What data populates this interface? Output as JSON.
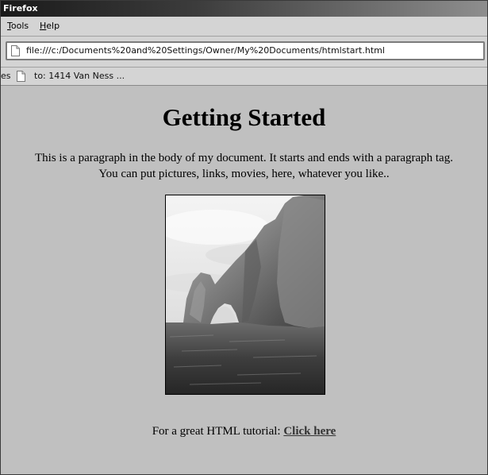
{
  "window": {
    "title": "Firefox"
  },
  "menu": {
    "items": [
      {
        "mnemonic": "T",
        "rest": "ools"
      },
      {
        "mnemonic": "H",
        "rest": "elp"
      }
    ]
  },
  "urlbar": {
    "value": "file:///c:/Documents%20and%20Settings/Owner/My%20Documents/htmlstart.html",
    "icon": "page-icon"
  },
  "bookmarks": {
    "cut_label": "es",
    "items": [
      {
        "label": "to: 1414 Van Ness ...",
        "icon": "page-icon"
      }
    ]
  },
  "page": {
    "heading": "Getting Started",
    "paragraph": "This is a paragraph in the body of my document. It starts and ends with a paragraph tag. You can put pictures, links, movies, here, whatever you like..",
    "image": {
      "icon": "photo-sea-arch"
    },
    "tutorial_prefix": "For a great HTML tutorial: ",
    "tutorial_link": "Click here"
  },
  "colors": {
    "content_background": "#c0c0c0",
    "chrome_background": "#d4d4d4",
    "link": "#333333"
  }
}
